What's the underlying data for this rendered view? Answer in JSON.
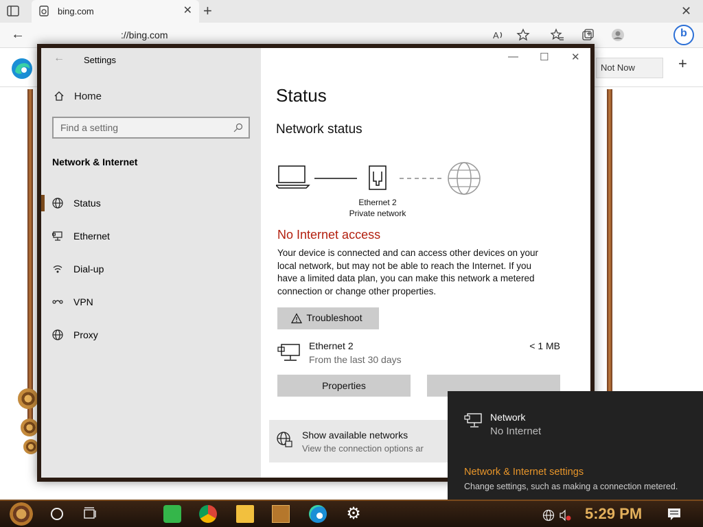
{
  "browser": {
    "tab_title": "bing.com",
    "address": "://bing.com",
    "not_now": "Not Now"
  },
  "settings": {
    "window_title": "Settings",
    "home": "Home",
    "search_placeholder": "Find a setting",
    "section": "Network & Internet",
    "nav": [
      {
        "label": "Status",
        "icon": "globe-icon"
      },
      {
        "label": "Ethernet",
        "icon": "ethernet-icon"
      },
      {
        "label": "Dial-up",
        "icon": "dialup-icon"
      },
      {
        "label": "VPN",
        "icon": "vpn-icon"
      },
      {
        "label": "Proxy",
        "icon": "globe-icon"
      }
    ],
    "page_title": "Status",
    "network_status": "Network status",
    "adapter_name": "Ethernet 2",
    "adapter_profile": "Private network",
    "no_internet": "No Internet access",
    "description": "Your device is connected and can access other devices on your local network, but may not be able to reach the Internet. If you have a limited data plan, you can make this network a metered connection or change other properties.",
    "troubleshoot": "Troubleshoot",
    "ethernet_row": {
      "name": "Ethernet 2",
      "sub": "From the last 30 days",
      "usage": "< 1 MB"
    },
    "properties": "Properties",
    "show_networks": {
      "title": "Show available networks",
      "sub": "View the connection options ar"
    }
  },
  "flyout": {
    "network_name": "Network",
    "network_status": "No Internet",
    "settings_link": "Network & Internet settings",
    "settings_sub": "Change settings, such as making a connection metered."
  },
  "taskbar": {
    "clock": "5:29 PM"
  },
  "colors": {
    "error_red": "#b3200f",
    "flyout_link": "#e7952a",
    "clock_gold": "#e3b05c"
  }
}
